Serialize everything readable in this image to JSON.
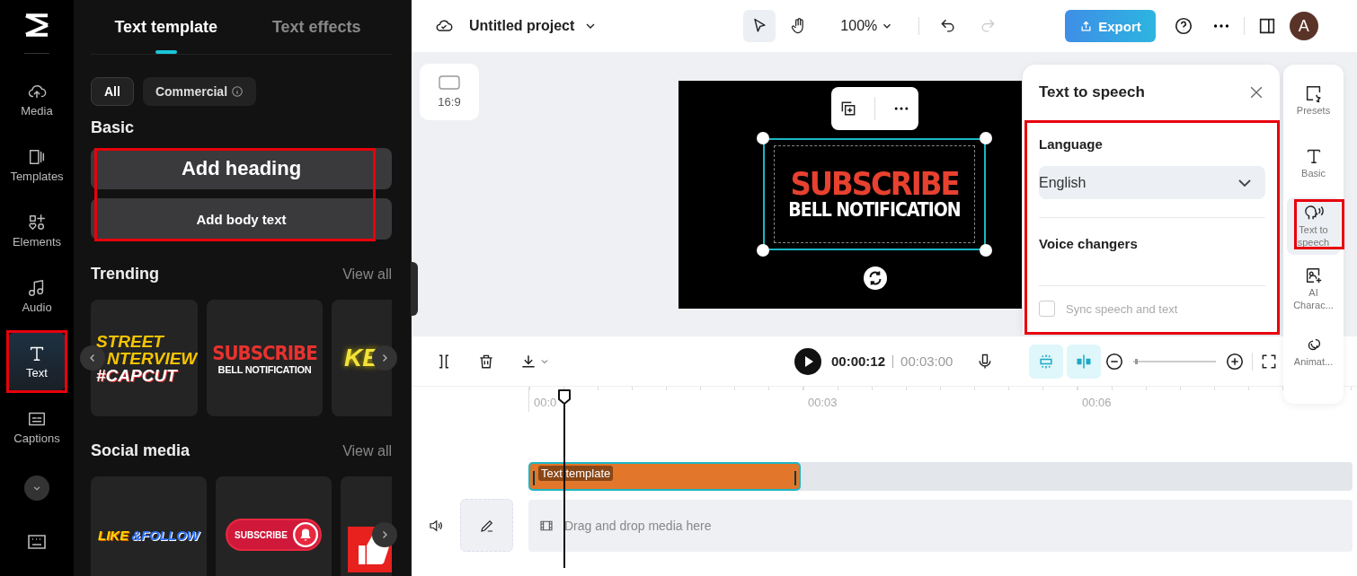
{
  "rail": {
    "items": [
      {
        "label": "Media",
        "selected": false,
        "highlighted": false
      },
      {
        "label": "Templates",
        "selected": false,
        "highlighted": false
      },
      {
        "label": "Elements",
        "selected": false,
        "highlighted": false
      },
      {
        "label": "Audio",
        "selected": false,
        "highlighted": false
      },
      {
        "label": "Text",
        "selected": true,
        "highlighted": true
      },
      {
        "label": "Captions",
        "selected": false,
        "highlighted": false
      }
    ]
  },
  "panel": {
    "tabs": [
      {
        "label": "Text template",
        "selected": true
      },
      {
        "label": "Text effects",
        "selected": false
      }
    ],
    "filters": [
      {
        "label": "All",
        "selected": true
      },
      {
        "label": "Commercial",
        "selected": false
      }
    ],
    "basic": {
      "title": "Basic",
      "highlighted": true,
      "buttons": [
        {
          "label": "Add heading",
          "kind": "heading"
        },
        {
          "label": "Add body text",
          "kind": "body"
        }
      ]
    },
    "trending": {
      "title": "Trending",
      "view_all": "View all",
      "thumbs": [
        {
          "kind": "street",
          "lines": [
            "STREET",
            "NTERVIEW",
            "#CAPCUT"
          ]
        },
        {
          "kind": "subscribe",
          "lines": [
            "SUBSCRIBE",
            "BELL NOTIFICATION"
          ]
        },
        {
          "kind": "glow",
          "lines": [
            "KE"
          ]
        }
      ]
    },
    "social": {
      "title": "Social media",
      "view_all": "View all",
      "thumbs": [
        {
          "kind": "like",
          "lines": [
            "LIKE",
            "&FOLLOW"
          ]
        },
        {
          "kind": "pill",
          "lines": [
            "SUBSCRIBE"
          ]
        },
        {
          "kind": "thumb"
        }
      ]
    }
  },
  "topbar": {
    "project": "Untitled project",
    "zoom": "100%",
    "export": "Export",
    "avatar": "A"
  },
  "canvas": {
    "ratio": "16:9",
    "preview_lines": [
      "SUBSCRIBE",
      "BELL NOTIFICATION"
    ]
  },
  "tts": {
    "title": "Text to speech",
    "highlighted": true,
    "language_label": "Language",
    "language": "English",
    "voice_label": "Voice changers",
    "sync": {
      "label": "Sync speech and text",
      "checked": false,
      "disabled": true
    }
  },
  "tools": [
    {
      "label": "Presets",
      "selected": false,
      "highlighted": false
    },
    {
      "label": "Basic",
      "selected": false,
      "highlighted": false
    },
    {
      "label": "Text to speech",
      "selected": true,
      "highlighted": true
    },
    {
      "label": "AI Charac...",
      "selected": false,
      "highlighted": false
    },
    {
      "label": "Animat...",
      "selected": false,
      "highlighted": false
    }
  ],
  "timeline": {
    "current": "00:00:12",
    "total": "00:03:00",
    "zoom": {
      "level": 0.02
    },
    "ruler": [
      "00:0",
      "00:03",
      "00:06"
    ],
    "clip": "Text template",
    "media_placeholder": "Drag and drop media here"
  }
}
